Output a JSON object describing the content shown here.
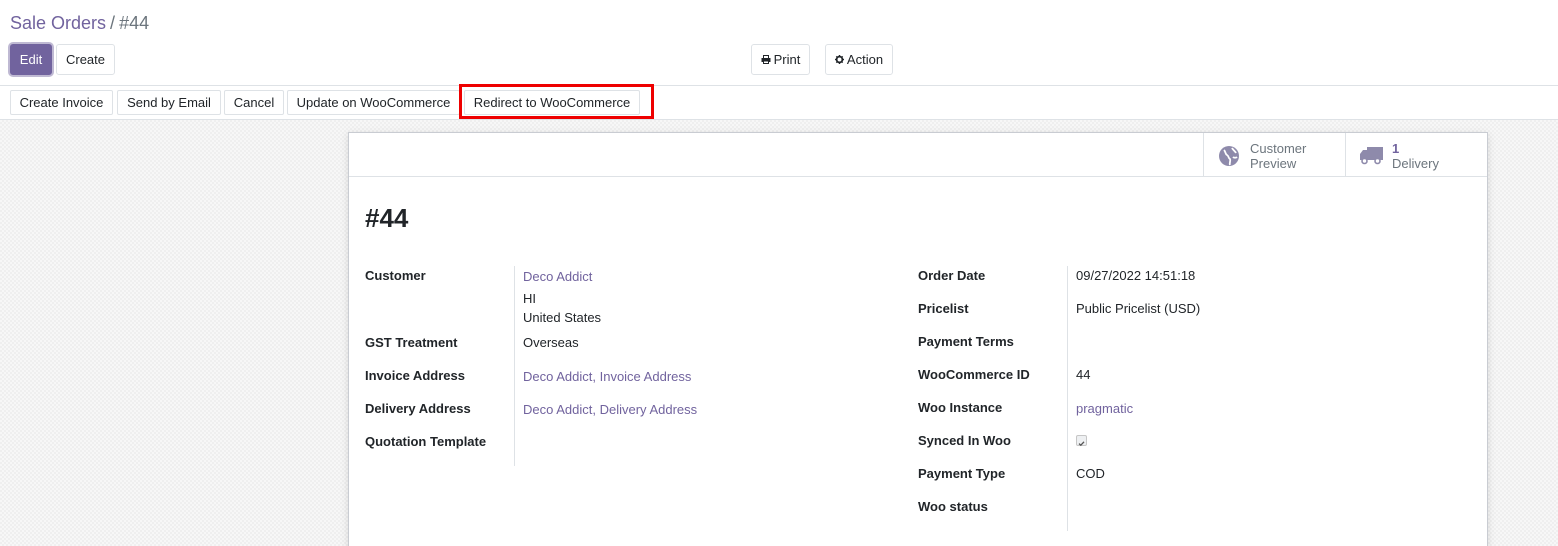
{
  "breadcrumb": {
    "parent": "Sale Orders",
    "separator": "/",
    "current": "#44"
  },
  "toolbar": {
    "edit_label": "Edit",
    "create_label": "Create",
    "print_label": "Print",
    "action_label": "Action",
    "print_icon": "printer-icon",
    "action_icon": "gear-icon"
  },
  "statusbar": {
    "buttons": [
      "Create Invoice",
      "Send by Email",
      "Cancel",
      "Update on WooCommerce",
      "Redirect to WooCommerce"
    ]
  },
  "smart_buttons": {
    "preview": {
      "icon": "globe-icon",
      "line1": "Customer",
      "line2": "Preview"
    },
    "delivery": {
      "icon": "truck-icon",
      "count": "1",
      "label": "Delivery"
    }
  },
  "record": {
    "title": "#44"
  },
  "left_fields": {
    "customer_label": "Customer",
    "customer_name": "Deco Addict",
    "customer_addr1": "HI",
    "customer_addr2": "United States",
    "gst_label": "GST Treatment",
    "gst_value": "Overseas",
    "invoice_label": "Invoice Address",
    "invoice_value": "Deco Addict, Invoice Address",
    "delivery_label": "Delivery Address",
    "delivery_value": "Deco Addict, Delivery Address",
    "template_label": "Quotation Template",
    "template_value": ""
  },
  "right_fields": {
    "order_date_label": "Order Date",
    "order_date_value": "09/27/2022 14:51:18",
    "pricelist_label": "Pricelist",
    "pricelist_value": "Public Pricelist (USD)",
    "payment_terms_label": "Payment Terms",
    "payment_terms_value": "",
    "woo_id_label": "WooCommerce ID",
    "woo_id_value": "44",
    "woo_instance_label": "Woo Instance",
    "woo_instance_value": "pragmatic",
    "synced_label": "Synced In Woo",
    "synced_value": true,
    "payment_type_label": "Payment Type",
    "payment_type_value": "COD",
    "woo_status_label": "Woo status",
    "woo_status_value": ""
  },
  "colors": {
    "brand": "#71639e",
    "highlight": "#ee0000"
  }
}
